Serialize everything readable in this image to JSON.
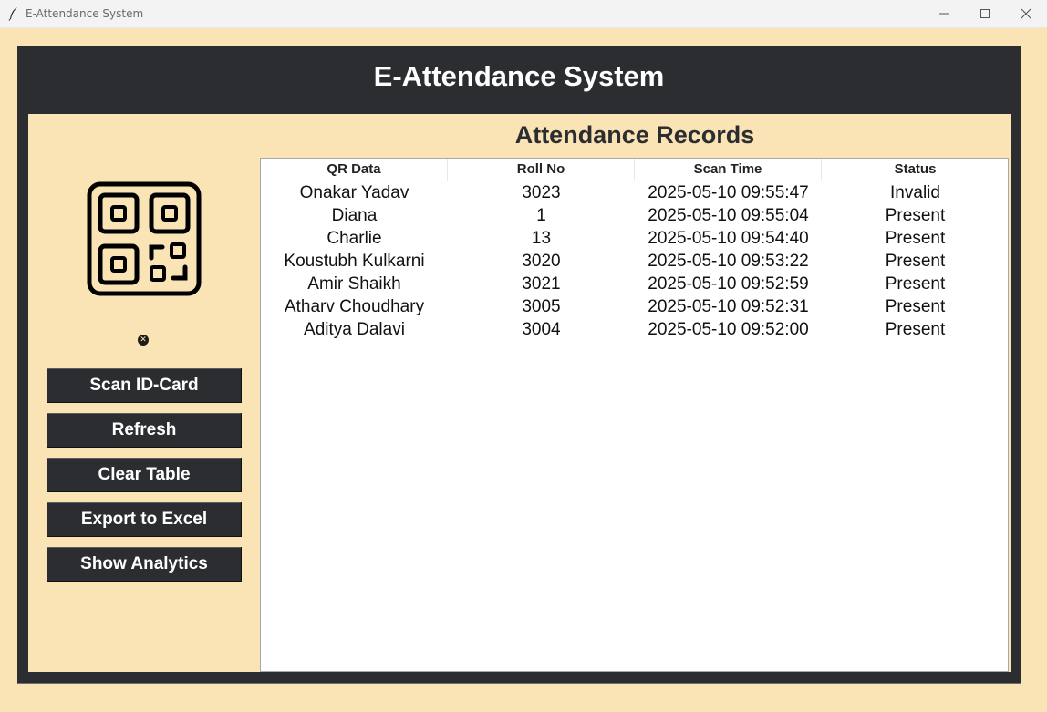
{
  "window": {
    "title": "E-Attendance System",
    "controls": [
      "minimize-icon",
      "maximize-icon",
      "close-icon"
    ]
  },
  "header": {
    "title": "E-Attendance System"
  },
  "sidebar": {
    "icon": "qr-code-icon",
    "status_icon": "close-circle-icon",
    "buttons": [
      {
        "label": "Scan ID-Card"
      },
      {
        "label": "Refresh"
      },
      {
        "label": "Clear Table"
      },
      {
        "label": "Export to Excel"
      },
      {
        "label": "Show Analytics"
      }
    ]
  },
  "records": {
    "title": "Attendance Records",
    "columns": [
      "QR Data",
      "Roll No",
      "Scan Time",
      "Status"
    ],
    "rows": [
      [
        "Onakar Yadav",
        "3023",
        "2025-05-10 09:55:47",
        "Invalid"
      ],
      [
        "Diana",
        "1",
        "2025-05-10 09:55:04",
        "Present"
      ],
      [
        "Charlie",
        "13",
        "2025-05-10 09:54:40",
        "Present"
      ],
      [
        "Koustubh Kulkarni",
        "3020",
        "2025-05-10 09:53:22",
        "Present"
      ],
      [
        "Amir Shaikh",
        "3021",
        "2025-05-10 09:52:59",
        "Present"
      ],
      [
        "Atharv Choudhary",
        "3005",
        "2025-05-10 09:52:31",
        "Present"
      ],
      [
        "Aditya Dalavi",
        "3004",
        "2025-05-10 09:52:00",
        "Present"
      ]
    ]
  },
  "colors": {
    "background": "#fae3b4",
    "dark": "#2b2d31",
    "table_bg": "#ffffff"
  }
}
